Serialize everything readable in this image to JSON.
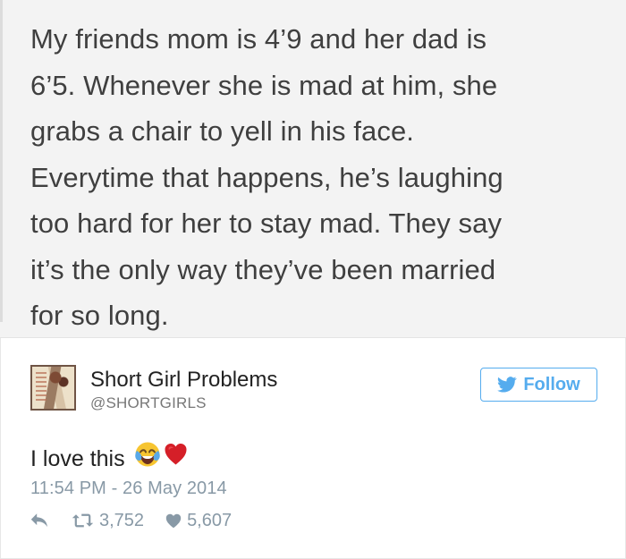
{
  "embedded_card": {
    "text": "My friends mom is 4’9 and her dad is\n6’5. Whenever she is mad at him, she\ngrabs a chair to yell in his face.\nEverytime that happens, he’s laughing\ntoo hard for her to stay mad. They say\nit’s the only way they’ve been married\nfor so long."
  },
  "author": {
    "name": "Short Girl Problems",
    "handle": "@SHORTGIRLS"
  },
  "follow_button": {
    "label": "Follow"
  },
  "tweet": {
    "text": "I love this",
    "emojis": [
      "laughing-crying-emoji",
      "red-heart-emoji"
    ],
    "timestamp": "11:54 PM - 26 May 2014"
  },
  "actions": {
    "reply": {
      "icon": "reply-icon"
    },
    "retweet": {
      "icon": "retweet-icon",
      "count": "3,752"
    },
    "like": {
      "icon": "heart-icon",
      "count": "5,607"
    }
  },
  "colors": {
    "embedded_background": "#f3f3f3",
    "embedded_text": "#3f3f3f",
    "twitter_blue": "#55acee",
    "secondary_text": "#8899a6",
    "heart_red": "#d51f28",
    "emoji_yellow": "#f7c531"
  }
}
